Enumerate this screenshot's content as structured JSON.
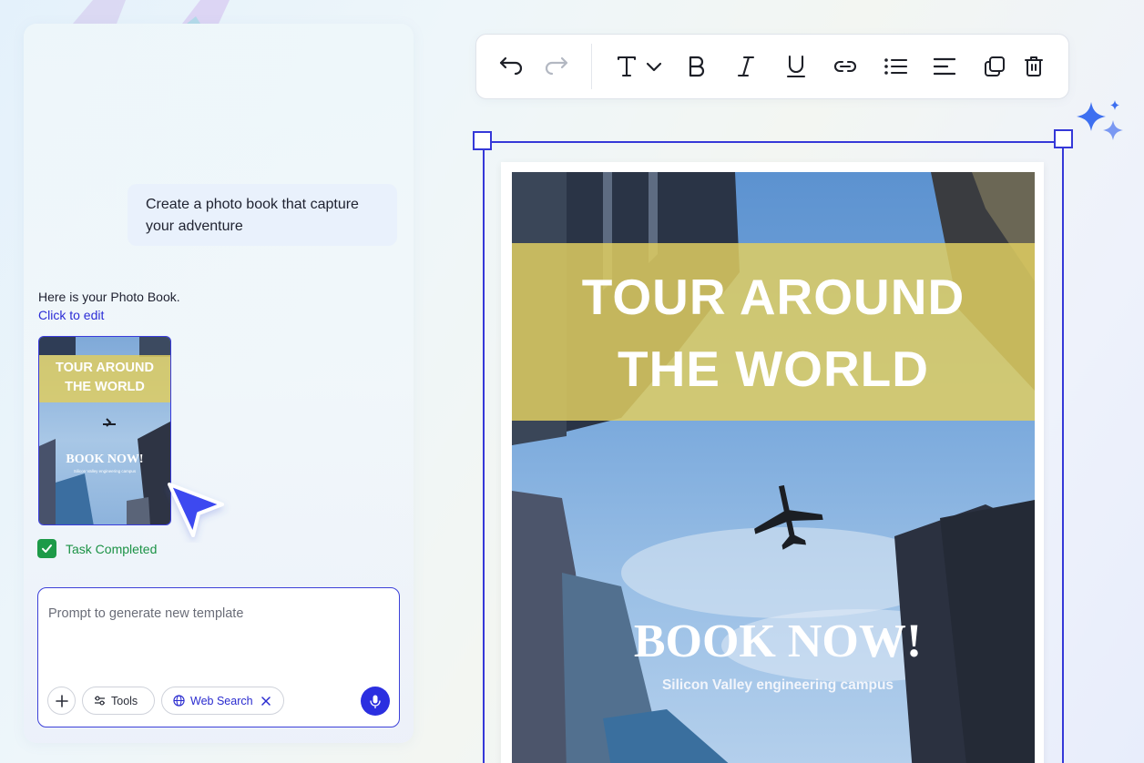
{
  "chat": {
    "user_message": "Create a photo book that capture your adventure",
    "ai_reply": "Here is your Photo Book.",
    "edit_link": "Click to edit",
    "thumbnail": {
      "title_line1": "TOUR AROUND",
      "title_line2": "THE WORLD",
      "book_now": "BOOK NOW!",
      "subtitle": "Silicon Valley engineering campus"
    },
    "task_status": "Task Completed"
  },
  "prompt": {
    "placeholder": "Prompt to generate new template",
    "tools_label": "Tools",
    "web_search_label": "Web Search"
  },
  "toolbar": {
    "buttons": [
      "undo",
      "redo",
      "text-style",
      "bold",
      "italic",
      "underline",
      "link",
      "bulleted-list",
      "align",
      "duplicate",
      "delete"
    ]
  },
  "canvas": {
    "title_line1": "TOUR AROUND",
    "title_line2": "THE WORLD",
    "book_now": "BOOK NOW!",
    "subtitle": "Silicon Valley engineering campus"
  },
  "colors": {
    "accent": "#3538d8",
    "success": "#1d9a48",
    "banner": "#dfce62"
  }
}
